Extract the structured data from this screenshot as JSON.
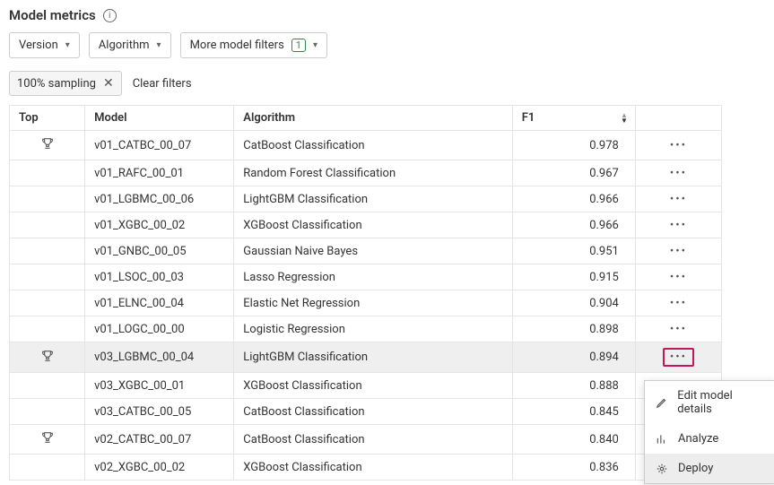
{
  "header": {
    "title": "Model metrics"
  },
  "filters": {
    "version_label": "Version",
    "algorithm_label": "Algorithm",
    "more_label": "More model filters",
    "more_count": "1"
  },
  "chips": {
    "sampling_label": "100% sampling",
    "clear_label": "Clear filters"
  },
  "columns": {
    "top": "Top",
    "model": "Model",
    "algorithm": "Algorithm",
    "f1": "F1"
  },
  "rows": [
    {
      "top": true,
      "model": "v01_CATBC_00_07",
      "algorithm": "CatBoost Classification",
      "f1": "0.978"
    },
    {
      "top": false,
      "model": "v01_RAFC_00_01",
      "algorithm": "Random Forest Classification",
      "f1": "0.967"
    },
    {
      "top": false,
      "model": "v01_LGBMC_00_06",
      "algorithm": "LightGBM Classification",
      "f1": "0.966"
    },
    {
      "top": false,
      "model": "v01_XGBC_00_02",
      "algorithm": "XGBoost Classification",
      "f1": "0.966"
    },
    {
      "top": false,
      "model": "v01_GNBC_00_05",
      "algorithm": "Gaussian Naive Bayes",
      "f1": "0.951"
    },
    {
      "top": false,
      "model": "v01_LSOC_00_03",
      "algorithm": "Lasso Regression",
      "f1": "0.915"
    },
    {
      "top": false,
      "model": "v01_ELNC_00_04",
      "algorithm": "Elastic Net Regression",
      "f1": "0.904"
    },
    {
      "top": false,
      "model": "v01_LOGC_00_00",
      "algorithm": "Logistic Regression",
      "f1": "0.898"
    },
    {
      "top": true,
      "model": "v03_LGBMC_00_04",
      "algorithm": "LightGBM Classification",
      "f1": "0.894",
      "highlight": true
    },
    {
      "top": false,
      "model": "v03_XGBC_00_01",
      "algorithm": "XGBoost Classification",
      "f1": "0.888"
    },
    {
      "top": false,
      "model": "v03_CATBC_00_05",
      "algorithm": "CatBoost Classification",
      "f1": "0.845"
    },
    {
      "top": true,
      "model": "v02_CATBC_00_07",
      "algorithm": "CatBoost Classification",
      "f1": "0.840"
    },
    {
      "top": false,
      "model": "v02_XGBC_00_02",
      "algorithm": "XGBoost Classification",
      "f1": "0.836"
    }
  ],
  "menu": {
    "edit": "Edit model details",
    "analyze": "Analyze",
    "deploy": "Deploy"
  }
}
